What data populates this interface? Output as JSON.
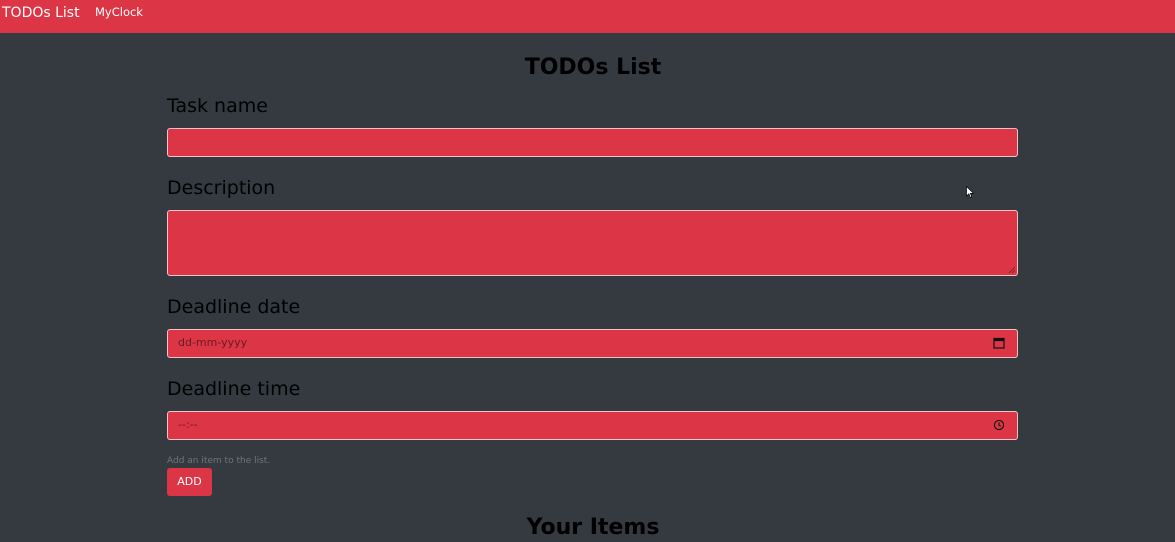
{
  "navbar": {
    "brand": "TODOs List",
    "links": [
      "MyClock"
    ]
  },
  "form": {
    "title": "TODOs List",
    "task_name": {
      "label": "Task name",
      "value": ""
    },
    "description": {
      "label": "Description",
      "value": ""
    },
    "deadline_date": {
      "label": "Deadline date",
      "placeholder": "dd-mm-yyyy",
      "icon": "calendar-icon"
    },
    "deadline_time": {
      "label": "Deadline time",
      "placeholder": "--:--",
      "icon": "clock-icon"
    },
    "help_text": "Add an item to the list.",
    "add_label": "ADD"
  },
  "items": {
    "title": "Your Items"
  },
  "colors": {
    "accent": "#dc3545",
    "background": "#343a40",
    "text": "#000000"
  }
}
